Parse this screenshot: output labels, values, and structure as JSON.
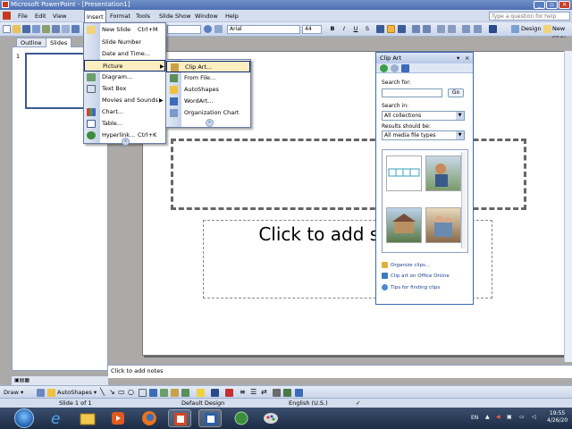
{
  "window": {
    "title": "Microsoft PowerPoint - [Presentation1]",
    "minimize": "_",
    "restore": "▫",
    "close": "×"
  },
  "menubar": {
    "items": [
      "File",
      "Edit",
      "View",
      "Insert",
      "Format",
      "Tools",
      "Slide Show",
      "Window",
      "Help"
    ],
    "active": "Insert",
    "help_placeholder": "Type a question for help"
  },
  "toolbar": {
    "font_name": "Arial",
    "font_size": "44",
    "bold": "B",
    "italic": "I",
    "underline": "U",
    "shadow": "S",
    "design_label": "Design",
    "new_slide_label": "New Slide"
  },
  "outline_tabs": {
    "outline": "Outline",
    "slides": "Slides"
  },
  "slide_number": "1",
  "slide": {
    "subtitle_placeholder": "Click to add subtitle"
  },
  "insert_menu": {
    "items": [
      {
        "label": "New Slide",
        "shortcut": "Ctrl+M",
        "icon": "new-slide-icon"
      },
      {
        "label": "Slide Number",
        "shortcut": "",
        "icon": ""
      },
      {
        "label": "Date and Time...",
        "shortcut": "",
        "icon": ""
      },
      {
        "label": "Picture",
        "shortcut": "",
        "icon": ""
      },
      {
        "label": "Diagram...",
        "shortcut": "",
        "icon": "diagram-icon"
      },
      {
        "label": "Text Box",
        "shortcut": "",
        "icon": "textbox-icon"
      },
      {
        "label": "Movies and Sounds",
        "shortcut": "",
        "icon": ""
      },
      {
        "label": "Chart...",
        "shortcut": "",
        "icon": "chart-icon"
      },
      {
        "label": "Table...",
        "shortcut": "",
        "icon": "table-icon"
      },
      {
        "label": "Hyperlink...",
        "shortcut": "Ctrl+K",
        "icon": "hyperlink-icon"
      }
    ],
    "expand": "»"
  },
  "picture_submenu": {
    "items": [
      "Clip Art...",
      "From File...",
      "AutoShapes",
      "WordArt...",
      "Organization Chart"
    ],
    "expand": "»"
  },
  "clipart_pane": {
    "title": "Clip Art",
    "search_for_label": "Search for:",
    "search_value": "",
    "go_label": "Go",
    "search_in_label": "Search in:",
    "search_in_value": "All collections",
    "results_label": "Results should be:",
    "results_value": "All media file types",
    "links": [
      "Organize clips...",
      "Clip art on Office Online",
      "Tips for finding clips"
    ]
  },
  "notes": {
    "placeholder": "Click to add notes"
  },
  "drawing_toolbar": {
    "draw_label": "Draw ▾",
    "autoshapes_label": "AutoShapes ▾"
  },
  "statusbar": {
    "slide": "Slide 1 of 1",
    "design": "Default Design",
    "language": "English (U.S.)"
  },
  "taskbar": {
    "lang": "EN",
    "time": "19:55",
    "date": "4/26/20"
  }
}
